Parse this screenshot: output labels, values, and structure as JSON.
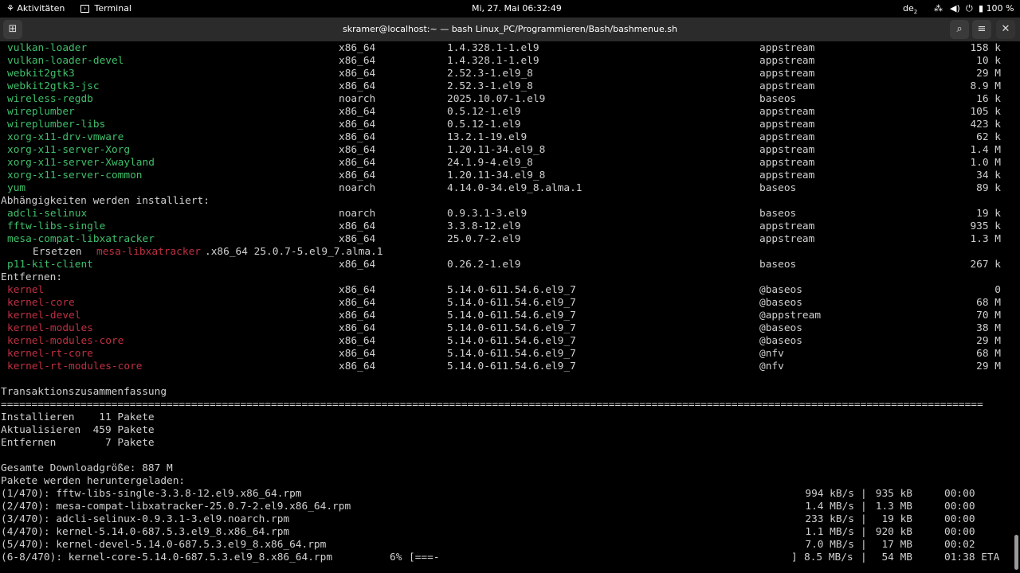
{
  "topbar": {
    "activities": "Aktivitäten",
    "app": "Terminal",
    "clock": "Mi, 27. Mai  06:32:49",
    "keyboard": "de",
    "keyboard_sub": "2",
    "battery": "100 %"
  },
  "window": {
    "title": "skramer@localhost:~ — bash Linux_PC/Programmieren/Bash/bashmenue.sh"
  },
  "packages_top": [
    {
      "name": "vulkan-loader",
      "arch": "x86_64",
      "version": "1.4.328.1-1.el9",
      "repo": "appstream",
      "size": "158 k"
    },
    {
      "name": "vulkan-loader-devel",
      "arch": "x86_64",
      "version": "1.4.328.1-1.el9",
      "repo": "appstream",
      "size": "10 k"
    },
    {
      "name": "webkit2gtk3",
      "arch": "x86_64",
      "version": "2.52.3-1.el9_8",
      "repo": "appstream",
      "size": "29 M"
    },
    {
      "name": "webkit2gtk3-jsc",
      "arch": "x86_64",
      "version": "2.52.3-1.el9_8",
      "repo": "appstream",
      "size": "8.9 M"
    },
    {
      "name": "wireless-regdb",
      "arch": "noarch",
      "version": "2025.10.07-1.el9",
      "repo": "baseos",
      "size": "16 k"
    },
    {
      "name": "wireplumber",
      "arch": "x86_64",
      "version": "0.5.12-1.el9",
      "repo": "appstream",
      "size": "105 k"
    },
    {
      "name": "wireplumber-libs",
      "arch": "x86_64",
      "version": "0.5.12-1.el9",
      "repo": "appstream",
      "size": "423 k"
    },
    {
      "name": "xorg-x11-drv-vmware",
      "arch": "x86_64",
      "version": "13.2.1-19.el9",
      "repo": "appstream",
      "size": "62 k"
    },
    {
      "name": "xorg-x11-server-Xorg",
      "arch": "x86_64",
      "version": "1.20.11-34.el9_8",
      "repo": "appstream",
      "size": "1.4 M"
    },
    {
      "name": "xorg-x11-server-Xwayland",
      "arch": "x86_64",
      "version": "24.1.9-4.el9_8",
      "repo": "appstream",
      "size": "1.0 M"
    },
    {
      "name": "xorg-x11-server-common",
      "arch": "x86_64",
      "version": "1.20.11-34.el9_8",
      "repo": "appstream",
      "size": "34 k"
    },
    {
      "name": "yum",
      "arch": "noarch",
      "version": "4.14.0-34.el9_8.alma.1",
      "repo": "baseos",
      "size": "89 k"
    }
  ],
  "deps_header": "Abhängigkeiten werden installiert:",
  "deps": [
    {
      "name": "adcli-selinux",
      "arch": "noarch",
      "version": "0.9.3.1-3.el9",
      "repo": "baseos",
      "size": "19 k"
    },
    {
      "name": "fftw-libs-single",
      "arch": "x86_64",
      "version": "3.3.8-12.el9",
      "repo": "appstream",
      "size": "935 k"
    },
    {
      "name": "mesa-compat-libxatracker",
      "arch": "x86_64",
      "version": "25.0.7-2.el9",
      "repo": "appstream",
      "size": "1.3 M"
    }
  ],
  "replace": {
    "label": "Ersetzen",
    "pkg": "mesa-libxatracker",
    "rest": ".x86_64 25.0.7-5.el9_7.alma.1"
  },
  "deps2": [
    {
      "name": "p11-kit-client",
      "arch": "x86_64",
      "version": "0.26.2-1.el9",
      "repo": "baseos",
      "size": "267 k"
    }
  ],
  "remove_header": "Entfernen:",
  "remove": [
    {
      "name": "kernel",
      "arch": "x86_64",
      "version": "5.14.0-611.54.6.el9_7",
      "repo": "@baseos",
      "size": "0"
    },
    {
      "name": "kernel-core",
      "arch": "x86_64",
      "version": "5.14.0-611.54.6.el9_7",
      "repo": "@baseos",
      "size": "68 M"
    },
    {
      "name": "kernel-devel",
      "arch": "x86_64",
      "version": "5.14.0-611.54.6.el9_7",
      "repo": "@appstream",
      "size": "70 M"
    },
    {
      "name": "kernel-modules",
      "arch": "x86_64",
      "version": "5.14.0-611.54.6.el9_7",
      "repo": "@baseos",
      "size": "38 M"
    },
    {
      "name": "kernel-modules-core",
      "arch": "x86_64",
      "version": "5.14.0-611.54.6.el9_7",
      "repo": "@baseos",
      "size": "29 M"
    },
    {
      "name": "kernel-rt-core",
      "arch": "x86_64",
      "version": "5.14.0-611.54.6.el9_7",
      "repo": "@nfv",
      "size": "68 M"
    },
    {
      "name": "kernel-rt-modules-core",
      "arch": "x86_64",
      "version": "5.14.0-611.54.6.el9_7",
      "repo": "@nfv",
      "size": "29 M"
    }
  ],
  "summary_header": "Transaktionszusammenfassung",
  "separator": "================================================================================================================================================================",
  "summary": [
    "Installieren    11 Pakete",
    "Aktualisieren  459 Pakete",
    "Entfernen        7 Pakete"
  ],
  "download_size": "Gesamte Downloadgröße: 887 M",
  "downloading": "Pakete werden heruntergeladen:",
  "downloads": [
    {
      "file": "(1/470): fftw-libs-single-3.3.8-12.el9.x86_64.rpm",
      "rate": "994 kB/s",
      "size": "935 kB",
      "time": "00:00"
    },
    {
      "file": "(2/470): mesa-compat-libxatracker-25.0.7-2.el9.x86_64.rpm",
      "rate": "1.4 MB/s",
      "size": "1.3 MB",
      "time": "00:00"
    },
    {
      "file": "(3/470): adcli-selinux-0.9.3.1-3.el9.noarch.rpm",
      "rate": "233 kB/s",
      "size": "19 kB",
      "time": "00:00"
    },
    {
      "file": "(4/470): kernel-5.14.0-687.5.3.el9_8.x86_64.rpm",
      "rate": "1.1 MB/s",
      "size": "920 kB",
      "time": "00:00"
    },
    {
      "file": "(5/470): kernel-devel-5.14.0-687.5.3.el9_8.x86_64.rpm",
      "rate": "7.0 MB/s",
      "size": "17 MB",
      "time": "00:02"
    }
  ],
  "progress": {
    "file": "(6-8/470): kernel-core-5.14.0-687.5.3.el9_8.x86_64.rpm",
    "percent": "6%",
    "bar": "[===-",
    "bar_end": "]",
    "rate": "8.5 MB/s",
    "size": "54 MB",
    "eta": "01:38 ETA"
  }
}
